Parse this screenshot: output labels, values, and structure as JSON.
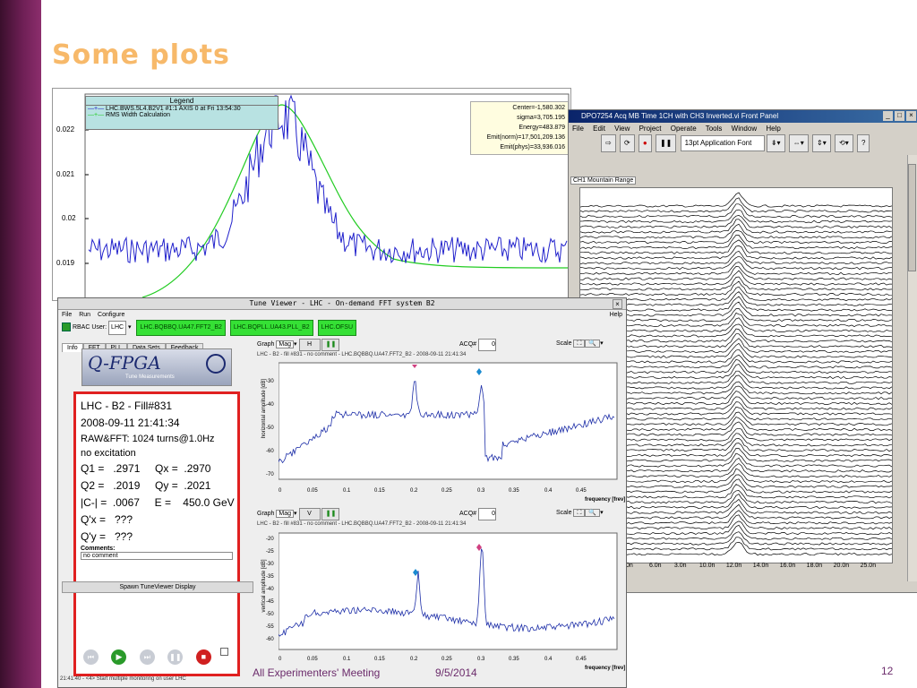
{
  "slide": {
    "title": "Some plots",
    "footer_meeting": "All Experimenters' Meeting",
    "footer_date": "9/5/2014",
    "page_number": "12"
  },
  "bws_plot": {
    "legend_title": "Legend",
    "legend_series1": "LHC.BWS.5L4.B2V1 #1:1 AXIS 0 at Fri 13:54:30",
    "legend_series2": "RMS Width Calculation",
    "stats": [
      "Center=-1,580.302",
      "sigma=3,705.195",
      "Energy=483.879",
      "Emit(norm)=17,501,209.136",
      "Emit(phys)=33,936.016"
    ],
    "yticks": [
      "0.022",
      "0.021",
      "0.02",
      "0.019"
    ],
    "colors": {
      "measured": "#2222cc",
      "fit": "#22cc22"
    }
  },
  "labview": {
    "title": "DPO7254 Acq MB Time 1CH with CH3 Inverted.vi Front Panel",
    "menu": [
      "File",
      "Edit",
      "View",
      "Project",
      "Operate",
      "Tools",
      "Window",
      "Help"
    ],
    "font_selector": "13pt Application Font",
    "graph_label": "CH1 Mountain Range",
    "xticks": [
      ".0n",
      "6.0n",
      "3.0n",
      "10.0n",
      "12.0n",
      "14.0n",
      "16.0n",
      "18.0n",
      "20.0n",
      "25.0n"
    ]
  },
  "tune_viewer": {
    "title": "Tune Viewer - LHC - On-demand FFT system B2",
    "menu": [
      "File",
      "Run",
      "Configure"
    ],
    "help": "Help",
    "rbac": "RBAC",
    "user_label": "User:",
    "user_value": "LHC",
    "devices": [
      "LHC.BQBBQ.UA47.FFT2_B2",
      "LHC.BQPLL.UA43.PLL_B2",
      "LHC.OFSU"
    ],
    "tabs": [
      "Info",
      "FFT",
      "PLL",
      "Data Sets",
      "Feedback"
    ],
    "logo_text": "Q-FPGA",
    "logo_sub": "Tune Measurements",
    "info": {
      "fill": "LHC - B2 - Fill#831",
      "datetime": "2008-09-11 21:41:34",
      "acq": "RAW&FFT: 1024 turns@1.0Hz",
      "excitation": "no excitation",
      "q1": "Q1 =   .2971     Qx =  .2970",
      "q2": "Q2 =   .2019     Qy =  .2021",
      "coupling": "|C-| =  .0067     E =    450.0 GeV",
      "qpx": "Q'x =   ???",
      "qpy": "Q'y =   ???",
      "comments_label": "Comments:",
      "comments_value": "no comment"
    },
    "spawn_button": "Spawn TuneViewer Display",
    "status_bar": "21:41:40 - <4> Start multiple monitoring on user LHC",
    "graph_label": "Graph",
    "graph_mode": "Mag",
    "acq_label": "ACQ#",
    "acq_value": "0",
    "scale_label": "Scale",
    "graph_h": {
      "plane": "H",
      "caption": "LHC - B2 - fill #831 - no comment - LHC.BQBBQ.UA47.FFT2_B2 - 2008-09-11 21:41:34",
      "ylabel": "horizontal amplitude [dB]",
      "yticks": [
        "-30",
        "-40",
        "-50",
        "-60",
        "-70"
      ],
      "xticks": [
        "0",
        "0.05",
        "0.1",
        "0.15",
        "0.2",
        "0.25",
        "0.3",
        "0.35",
        "0.4",
        "0.45"
      ],
      "xlabel": "frequency [frev]"
    },
    "graph_v": {
      "plane": "V",
      "caption": "LHC - B2 - fill #831 - no comment - LHC.BQBBQ.UA47.FFT2_B2 - 2008-09-11 21:41:34",
      "ylabel": "vertical amplitude [dB]",
      "yticks": [
        "-20",
        "-25",
        "-30",
        "-35",
        "-40",
        "-45",
        "-50",
        "-55",
        "-60"
      ],
      "xticks": [
        "0",
        "0.05",
        "0.1",
        "0.15",
        "0.2",
        "0.25",
        "0.3",
        "0.35",
        "0.4",
        "0.45"
      ],
      "xlabel": "frequency [frev]"
    }
  }
}
